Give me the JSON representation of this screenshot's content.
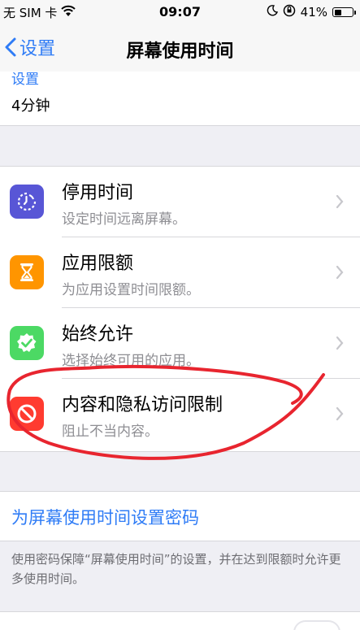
{
  "status_bar": {
    "carrier": "无 SIM 卡",
    "time": "09:07",
    "battery": "41%",
    "battery_level": 0.41,
    "icons": [
      "wifi-icon",
      "moon-icon",
      "orientation-lock-icon",
      "battery-icon"
    ]
  },
  "nav": {
    "back_label": "设置",
    "title": "屏幕使用时间"
  },
  "top_card": {
    "link": "设置",
    "value": "4分钟"
  },
  "menu": [
    {
      "title": "停用时间",
      "subtitle": "设定时间远离屏幕。",
      "icon": "downtime-icon",
      "color": "#5856d6"
    },
    {
      "title": "应用限额",
      "subtitle": "为应用设置时间限额。",
      "icon": "hourglass-icon",
      "color": "#ff9500"
    },
    {
      "title": "始终允许",
      "subtitle": "选择始终可用的应用。",
      "icon": "checkmark-badge-icon",
      "color": "#4cd964"
    },
    {
      "title": "内容和隐私访问限制",
      "subtitle": "阻止不当内容。",
      "icon": "no-entry-icon",
      "color": "#ff3b30"
    }
  ],
  "passcode": {
    "link": "为屏幕使用时间设置密码",
    "footnote": "使用密码保障“屏幕使用时间”的设置，并在达到限额时允许更多使用时间。"
  },
  "colors": {
    "accent": "#2f7cf6",
    "annotation": "#e8252f"
  }
}
